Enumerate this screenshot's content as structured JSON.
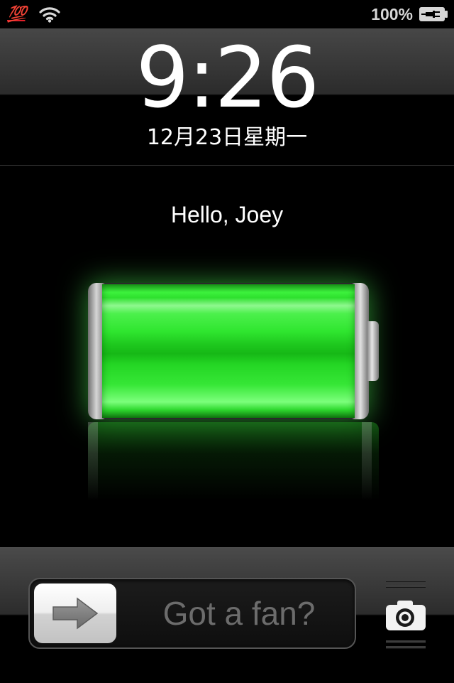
{
  "status_bar": {
    "left_emoji": "💯",
    "battery_percent": "100%",
    "icons": [
      "hundred-points-emoji",
      "wifi-icon",
      "charging-battery-icon"
    ]
  },
  "lock_screen": {
    "time": "9:26",
    "date": "12月23日星期一",
    "greeting": "Hello, Joey"
  },
  "charging": {
    "level": 1.0,
    "color": "#33e833"
  },
  "slider": {
    "label": "Got a fan?"
  },
  "colors": {
    "background": "#000000",
    "slider_label": "#6c6c6c",
    "emoji_red": "#e0202a"
  }
}
